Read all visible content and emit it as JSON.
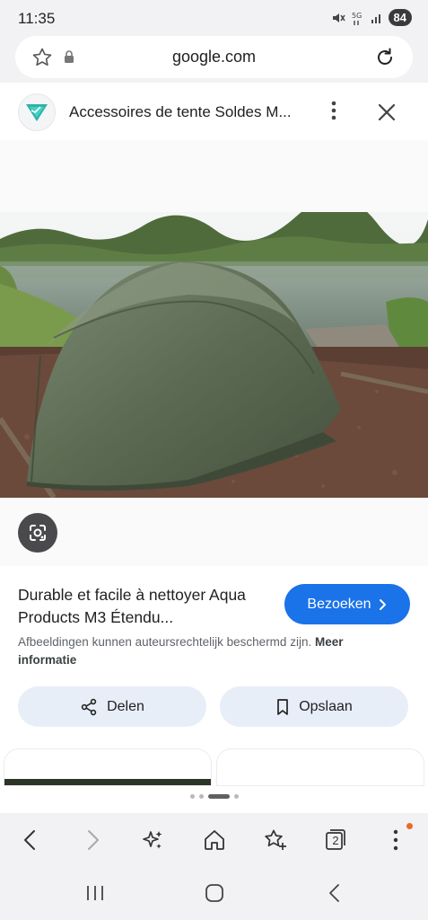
{
  "status_bar": {
    "time": "11:35",
    "network": "5G",
    "battery": "84"
  },
  "browser": {
    "url": "google.com"
  },
  "tab": {
    "title": "Accessoires de tente Soldes M..."
  },
  "result": {
    "title": "Durable et facile à nettoyer Aqua Products M3 Étendu...",
    "visit_label": "Bezoeken",
    "copyright_text": "Afbeeldingen kunnen auteursrechtelijk beschermd zijn.",
    "more_info_label": "Meer informatie",
    "share_label": "Delen",
    "save_label": "Opslaan"
  },
  "toolbar": {
    "tab_count": "2"
  },
  "icons": {
    "star": "star-icon",
    "lock": "lock-icon",
    "reload": "reload-icon",
    "menu": "more-vertical-icon",
    "close": "close-icon",
    "lens": "google-lens-icon",
    "chevron": "chevron-right-icon",
    "share": "share-icon",
    "bookmark": "bookmark-icon",
    "back": "back-icon",
    "forward": "forward-icon",
    "ai": "sparkle-icon",
    "home": "home-icon",
    "bookmarks": "bookmark-star-icon",
    "tabs": "tabs-icon",
    "more": "more-vertical-icon"
  },
  "colors": {
    "accent": "#1a73e8",
    "action_bg": "#e8eef8",
    "chrome_bg": "#f2f2f4",
    "notification": "#ea6a2b"
  }
}
